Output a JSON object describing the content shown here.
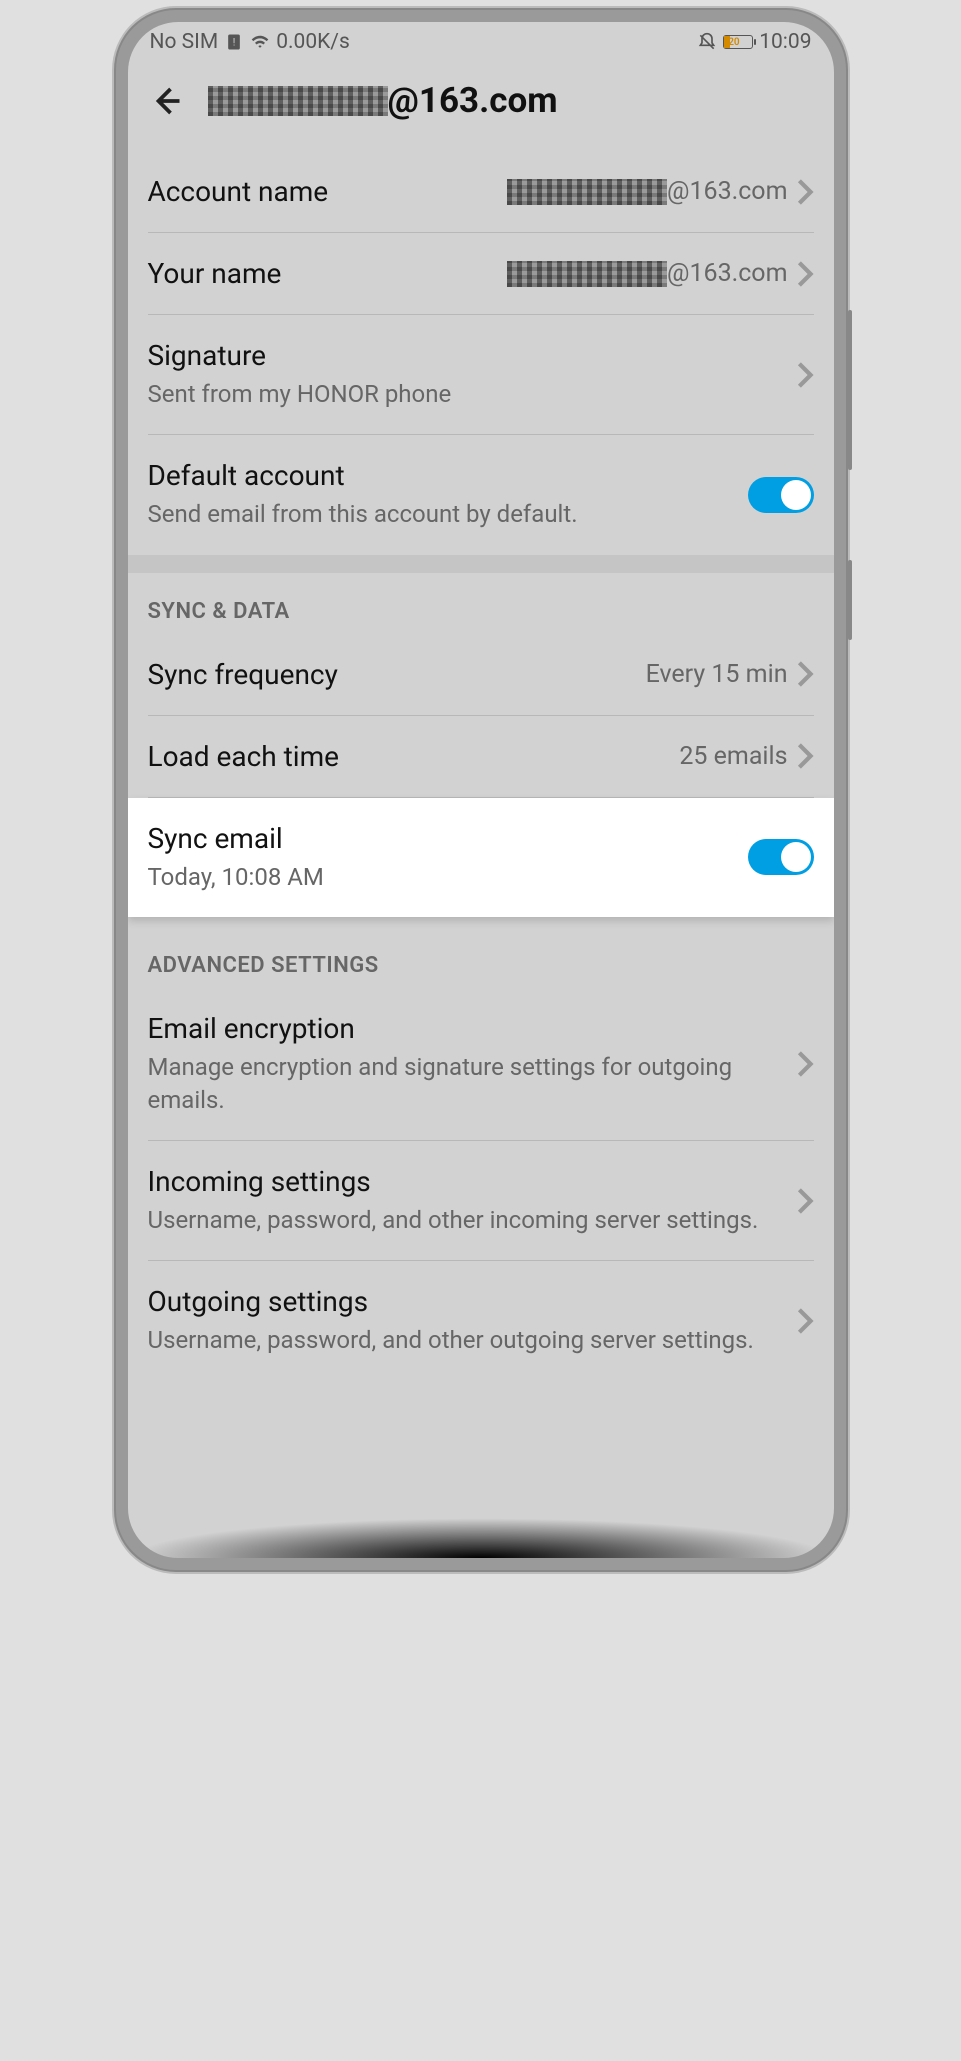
{
  "status": {
    "left": "No SIM",
    "speed": "0.00K/s",
    "battery": "20",
    "time": "10:09"
  },
  "header": {
    "suffix": "@163.com"
  },
  "rows": {
    "account": {
      "label": "Account name",
      "suffix": "@163.com"
    },
    "yourname": {
      "label": "Your name",
      "suffix": "@163.com"
    },
    "signature": {
      "label": "Signature",
      "sub": "Sent from my HONOR phone"
    },
    "default": {
      "label": "Default account",
      "sub": "Send email from this account by default."
    }
  },
  "sections": {
    "sync": "SYNC & DATA",
    "adv": "ADVANCED SETTINGS"
  },
  "sync": {
    "freq": {
      "label": "Sync frequency",
      "value": "Every 15 min"
    },
    "load": {
      "label": "Load each time",
      "value": "25 emails"
    },
    "email": {
      "label": "Sync email",
      "sub": "Today, 10:08 AM"
    }
  },
  "adv": {
    "enc": {
      "label": "Email encryption",
      "sub": "Manage encryption and signature settings for outgoing emails."
    },
    "inc": {
      "label": "Incoming settings",
      "sub": "Username, password, and other incoming server settings."
    },
    "out": {
      "label": "Outgoing settings",
      "sub": "Username, password, and other outgoing server settings."
    }
  }
}
